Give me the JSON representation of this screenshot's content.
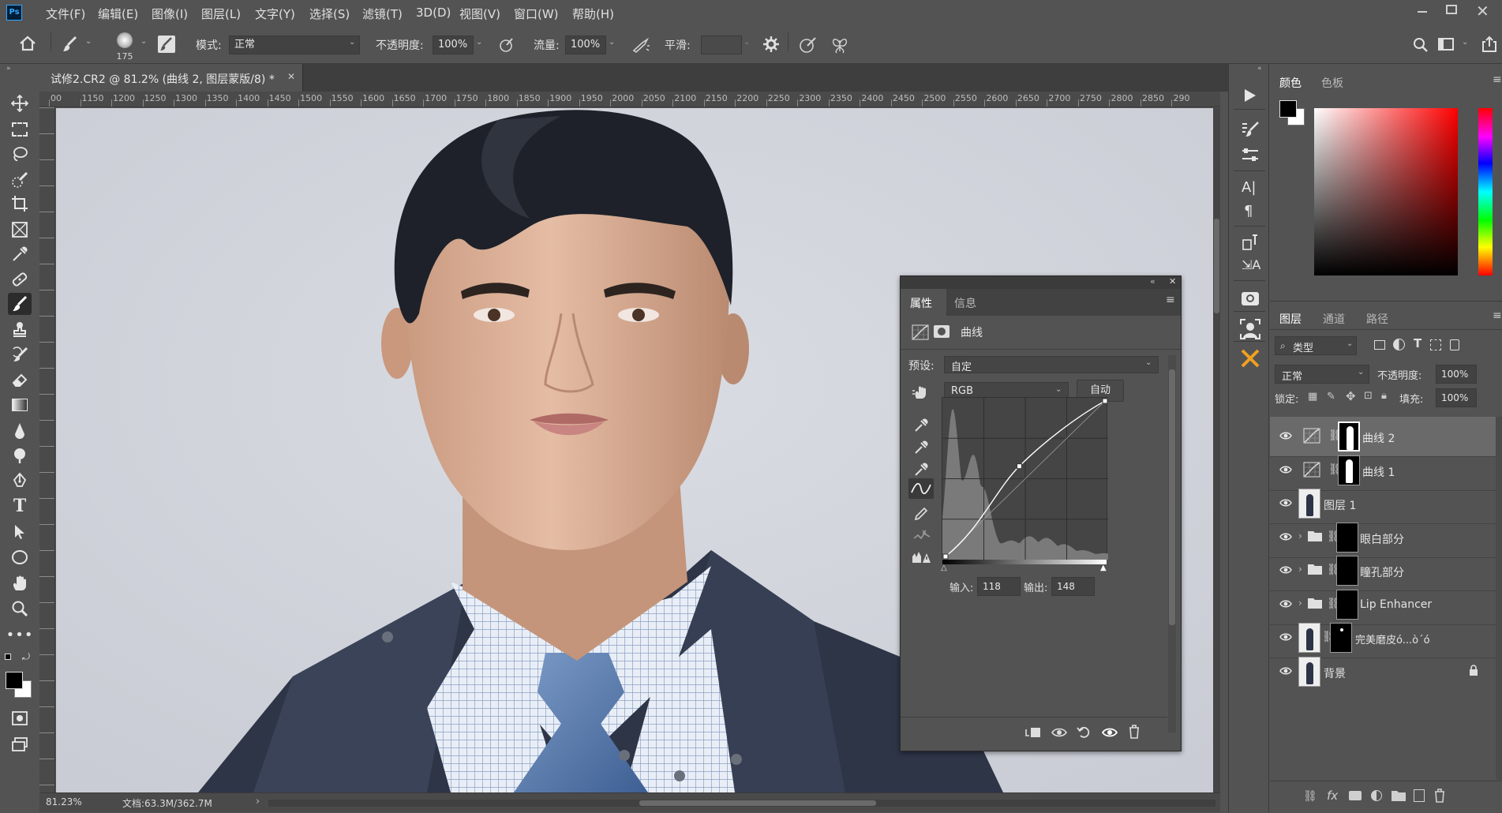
{
  "app": {
    "logo": "Ps"
  },
  "menu": [
    "文件(F)",
    "编辑(E)",
    "图像(I)",
    "图层(L)",
    "文字(Y)",
    "选择(S)",
    "滤镜(T)",
    "3D(D)",
    "视图(V)",
    "窗口(W)",
    "帮助(H)"
  ],
  "options": {
    "brush_size": "175",
    "mode_label": "模式:",
    "mode_value": "正常",
    "opacity_label": "不透明度:",
    "opacity_value": "100%",
    "flow_label": "流量:",
    "flow_value": "100%",
    "smooth_label": "平滑:"
  },
  "document": {
    "tab_title": "试修2.CR2 @ 81.2% (曲线 2, 图层蒙版/8) *",
    "zoom": "81.23%",
    "doc_size": "文档:63.3M/362.7M",
    "ruler_ticks": [
      "00",
      "1150",
      "1200",
      "1250",
      "1300",
      "1350",
      "1400",
      "1450",
      "1500",
      "1550",
      "1600",
      "1650",
      "1700",
      "1750",
      "1800",
      "1850",
      "1900",
      "1950",
      "2000",
      "2050",
      "2100",
      "2150",
      "2200",
      "2250",
      "2300",
      "2350",
      "2400",
      "2450",
      "2500",
      "2550",
      "2600",
      "2650",
      "2700",
      "2750",
      "2800",
      "2850",
      "290"
    ]
  },
  "properties": {
    "tabs": [
      "属性",
      "信息"
    ],
    "adjustment_name": "曲线",
    "preset_label": "预设:",
    "preset_value": "自定",
    "channel_value": "RGB",
    "auto_label": "自动",
    "input_label": "输入:",
    "input_value": "118",
    "output_label": "输出:",
    "output_value": "148",
    "curve_point": {
      "input": 118,
      "output": 148
    }
  },
  "color_panel": {
    "tabs": [
      "颜色",
      "色板"
    ],
    "foreground": "#000000",
    "background": "#ffffff"
  },
  "layers_panel": {
    "tabs": [
      "图层",
      "通道",
      "路径"
    ],
    "filter_kind": "类型",
    "blend_mode": "正常",
    "opacity_label": "不透明度:",
    "opacity_value": "100%",
    "lock_label": "锁定:",
    "fill_label": "填充:",
    "fill_value": "100%",
    "layers": [
      {
        "name": "曲线 2",
        "kind": "curves",
        "selected": true
      },
      {
        "name": "曲线 1",
        "kind": "curves"
      },
      {
        "name": "图层 1",
        "kind": "pixel"
      },
      {
        "name": "眼白部分",
        "kind": "group"
      },
      {
        "name": "瞳孔部分",
        "kind": "group"
      },
      {
        "name": "Lip Enhancer",
        "kind": "group"
      },
      {
        "name": "完美磨皮ó...ò´ó",
        "kind": "masked"
      },
      {
        "name": "背景",
        "kind": "background"
      }
    ]
  }
}
